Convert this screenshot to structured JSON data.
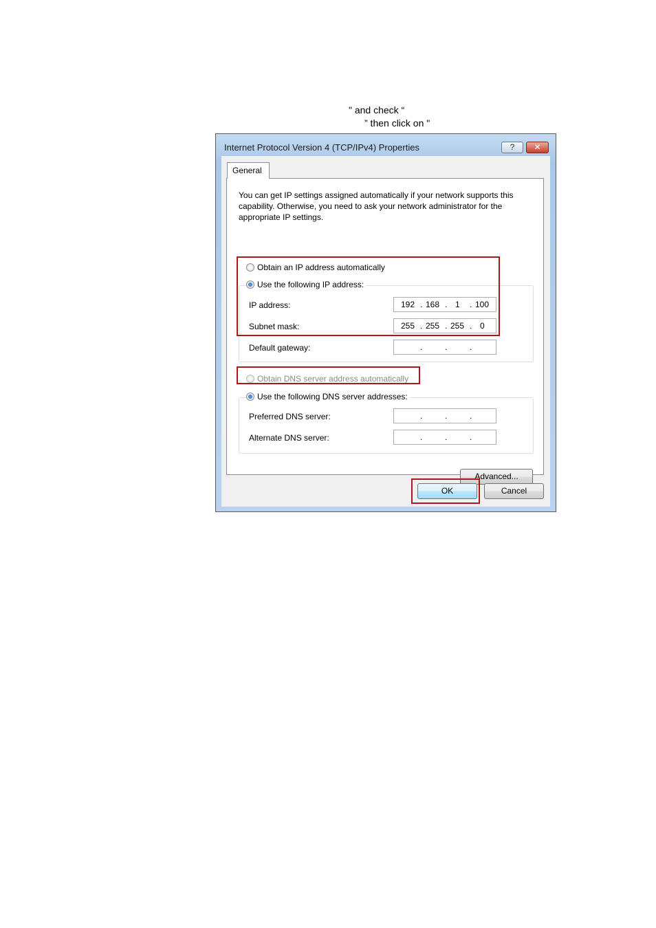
{
  "document": {
    "line1": "\" and check “",
    "line2": "” then click on \""
  },
  "dialog": {
    "title": "Internet Protocol Version 4 (TCP/IPv4) Properties",
    "help_label": "?",
    "close_label": "✕",
    "tab_general": "General",
    "description": "You can get IP settings assigned automatically if your network supports this capability. Otherwise, you need to ask your network administrator for the appropriate IP settings.",
    "ip_section": {
      "auto_label": "Obtain an IP address automatically",
      "manual_label": "Use the following IP address:",
      "selected": "manual",
      "fields": {
        "ip_label": "IP address:",
        "ip_octets": [
          "192",
          "168",
          "1",
          "100"
        ],
        "subnet_label": "Subnet mask:",
        "subnet_octets": [
          "255",
          "255",
          "255",
          "0"
        ],
        "gateway_label": "Default gateway:",
        "gateway_octets": [
          "",
          "",
          "",
          ""
        ]
      }
    },
    "dns_section": {
      "auto_label": "Obtain DNS server address automatically",
      "auto_enabled": false,
      "manual_label": "Use the following DNS server addresses:",
      "selected": "manual",
      "preferred_label": "Preferred DNS server:",
      "alternate_label": "Alternate DNS server:"
    },
    "advanced_label": "Advanced...",
    "ok_label": "OK",
    "cancel_label": "Cancel"
  },
  "colors": {
    "highlight": "#b2141b",
    "title_bar": "#b9d3ee"
  }
}
